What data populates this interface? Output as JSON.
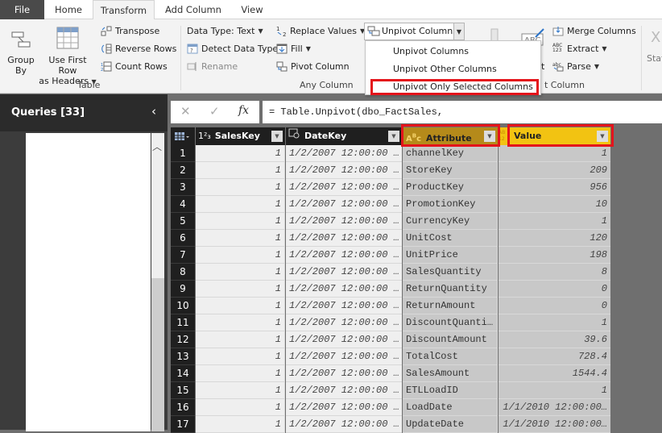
{
  "tabs": [
    "File",
    "Home",
    "Transform",
    "Add Column",
    "View"
  ],
  "ribbon": {
    "table_group": {
      "label": "Table",
      "group_by": "Group\nBy",
      "group_by_l1": "Group",
      "group_by_l2": "By",
      "use_first_row_l1": "Use First Row",
      "use_first_row_l2": "as Headers",
      "transpose": "Transpose",
      "reverse_rows": "Reverse Rows",
      "count_rows": "Count Rows"
    },
    "any_column_group": {
      "label": "Any Column",
      "data_type": "Data Type: Text",
      "detect_data_type": "Detect Data Type",
      "rename": "Rename",
      "replace_values": "Replace Values",
      "fill": "Fill",
      "pivot_column": "Pivot Column",
      "unpivot_columns": "Unpivot Columns"
    },
    "text_column_group": {
      "label_partial": "t Column",
      "format_partial": "t",
      "merge_columns": "Merge Columns",
      "extract": "Extract",
      "parse": "Parse"
    },
    "stat_partial": "Stat"
  },
  "unpivot_menu": {
    "items": [
      "Unpivot Columns",
      "Unpivot Other Columns",
      "Unpivot Only Selected Columns"
    ],
    "highlighted": "Unpivot Only Selected Columns"
  },
  "queries": {
    "title": "Queries [33]"
  },
  "formula_bar": {
    "cancel": "✕",
    "confirm": "✓",
    "fx": "fx",
    "formula": "= Table.Unpivot(dbo_FactSales,"
  },
  "grid": {
    "columns": [
      {
        "type_icon": "1²₃",
        "name": "SalesKey"
      },
      {
        "type_icon": "date-time",
        "name": "DateKey"
      },
      {
        "type_icon": "ABC",
        "name": "Attribute"
      },
      {
        "type_icon": "ABC123",
        "name": "Value"
      }
    ],
    "rows": [
      {
        "n": "1",
        "saleskey": "1",
        "datekey": "1/2/2007 12:00:00 …",
        "attribute": "channelKey",
        "value": "1"
      },
      {
        "n": "2",
        "saleskey": "1",
        "datekey": "1/2/2007 12:00:00 …",
        "attribute": "StoreKey",
        "value": "209"
      },
      {
        "n": "3",
        "saleskey": "1",
        "datekey": "1/2/2007 12:00:00 …",
        "attribute": "ProductKey",
        "value": "956"
      },
      {
        "n": "4",
        "saleskey": "1",
        "datekey": "1/2/2007 12:00:00 …",
        "attribute": "PromotionKey",
        "value": "10"
      },
      {
        "n": "5",
        "saleskey": "1",
        "datekey": "1/2/2007 12:00:00 …",
        "attribute": "CurrencyKey",
        "value": "1"
      },
      {
        "n": "6",
        "saleskey": "1",
        "datekey": "1/2/2007 12:00:00 …",
        "attribute": "UnitCost",
        "value": "120"
      },
      {
        "n": "7",
        "saleskey": "1",
        "datekey": "1/2/2007 12:00:00 …",
        "attribute": "UnitPrice",
        "value": "198"
      },
      {
        "n": "8",
        "saleskey": "1",
        "datekey": "1/2/2007 12:00:00 …",
        "attribute": "SalesQuantity",
        "value": "8"
      },
      {
        "n": "9",
        "saleskey": "1",
        "datekey": "1/2/2007 12:00:00 …",
        "attribute": "ReturnQuantity",
        "value": "0"
      },
      {
        "n": "10",
        "saleskey": "1",
        "datekey": "1/2/2007 12:00:00 …",
        "attribute": "ReturnAmount",
        "value": "0"
      },
      {
        "n": "11",
        "saleskey": "1",
        "datekey": "1/2/2007 12:00:00 …",
        "attribute": "DiscountQuanti…",
        "value": "1"
      },
      {
        "n": "12",
        "saleskey": "1",
        "datekey": "1/2/2007 12:00:00 …",
        "attribute": "DiscountAmount",
        "value": "39.6"
      },
      {
        "n": "13",
        "saleskey": "1",
        "datekey": "1/2/2007 12:00:00 …",
        "attribute": "TotalCost",
        "value": "728.4"
      },
      {
        "n": "14",
        "saleskey": "1",
        "datekey": "1/2/2007 12:00:00 …",
        "attribute": "SalesAmount",
        "value": "1544.4"
      },
      {
        "n": "15",
        "saleskey": "1",
        "datekey": "1/2/2007 12:00:00 …",
        "attribute": "ETLLoadID",
        "value": "1"
      },
      {
        "n": "16",
        "saleskey": "1",
        "datekey": "1/2/2007 12:00:00 …",
        "attribute": "LoadDate",
        "value": "1/1/2010 12:00:00…"
      },
      {
        "n": "17",
        "saleskey": "1",
        "datekey": "1/2/2007 12:00:00 …",
        "attribute": "UpdateDate",
        "value": "1/1/2010 12:00:00…"
      }
    ]
  },
  "colors": {
    "highlight": "#e4141b",
    "attribute_header": "#b58a1a",
    "value_header": "#f2c312"
  }
}
